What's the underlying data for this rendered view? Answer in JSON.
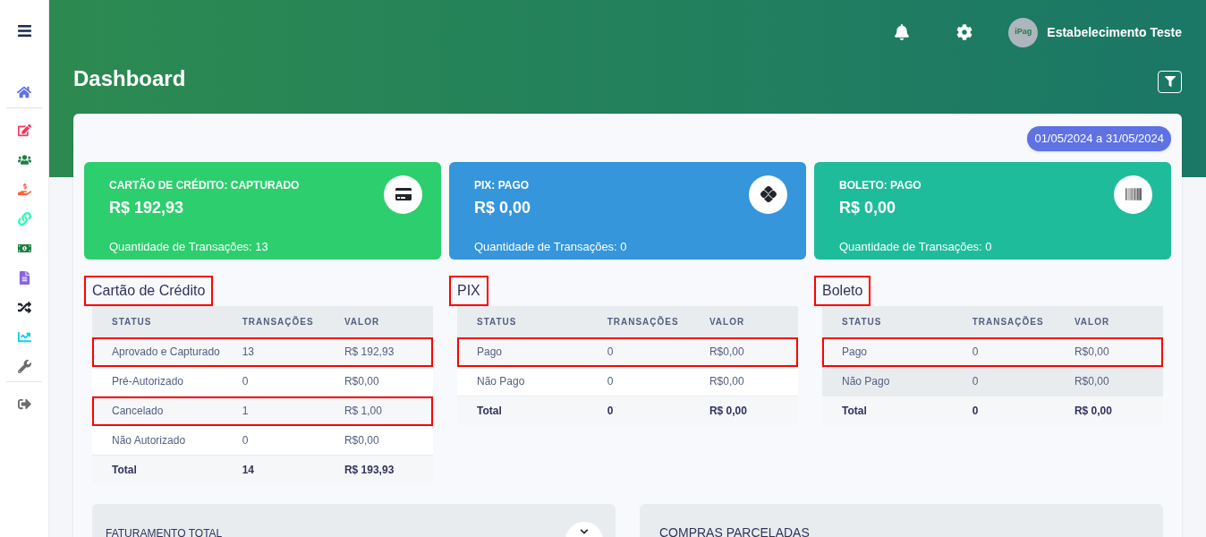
{
  "sidebar": {
    "items": [
      {
        "kind": "home",
        "color": "#5e72e4",
        "selected": true
      },
      {
        "kind": "edit",
        "color": "#f5365c",
        "selected": false
      },
      {
        "kind": "users",
        "color": "#1e7e46",
        "selected": false
      },
      {
        "kind": "hand",
        "color": "#fb6340",
        "selected": false
      },
      {
        "kind": "link",
        "color": "#2dfbb3",
        "selected": false
      },
      {
        "kind": "money",
        "color": "#1e7e46",
        "selected": false
      },
      {
        "kind": "file",
        "color": "#8965e0",
        "selected": false
      },
      {
        "kind": "shuffle",
        "color": "#212529",
        "selected": false
      },
      {
        "kind": "chart",
        "color": "#11cdef",
        "selected": false
      },
      {
        "kind": "wrench",
        "color": "#6c6c6c",
        "selected": false
      },
      {
        "kind": "logout",
        "color": "#6c6c6c",
        "selected": false
      }
    ]
  },
  "header": {
    "avatar_text": "iPag",
    "user_name": "Estabelecimento Teste"
  },
  "page_title": "Dashboard",
  "date_range": "01/05/2024 a 31/05/2024",
  "stat_cards": [
    {
      "kind": "card",
      "color": "#2dce6e",
      "title": "CARTÃO DE CRÉDITO: CAPTURADO",
      "amount": "R$ 192,93",
      "count": "Quantidade de Transações: 13"
    },
    {
      "kind": "pix",
      "color": "#3596db",
      "title": "PIX: PAGO",
      "amount": "R$ 0,00",
      "count": "Quantidade de Transações: 0"
    },
    {
      "kind": "barcode",
      "color": "#1fbc9c",
      "title": "BOLETO: PAGO",
      "amount": "R$ 0,00",
      "count": "Quantidade de Transações: 0"
    }
  ],
  "tables": [
    {
      "title": "Cartão de Crédito",
      "highlighted": true,
      "columns": [
        "STATUS",
        "TRANSAÇÕES",
        "VALOR"
      ],
      "rows": [
        {
          "cells": [
            "Aprovado e Capturado",
            "13",
            "R$ 192,93"
          ],
          "highlighted": true,
          "hovered": false
        },
        {
          "cells": [
            "Pré-Autorizado",
            "0",
            "R$0,00"
          ],
          "highlighted": false,
          "hovered": false
        },
        {
          "cells": [
            "Cancelado",
            "1",
            "R$ 1,00"
          ],
          "highlighted": true,
          "hovered": false
        },
        {
          "cells": [
            "Não Autorizado",
            "0",
            "R$0,00"
          ],
          "highlighted": false,
          "hovered": false
        }
      ],
      "total": [
        "Total",
        "14",
        "R$ 193,93"
      ]
    },
    {
      "title": "PIX",
      "highlighted": true,
      "columns": [
        "STATUS",
        "TRANSAÇÕES",
        "VALOR"
      ],
      "rows": [
        {
          "cells": [
            "Pago",
            "0",
            "R$0,00"
          ],
          "highlighted": true,
          "hovered": false
        },
        {
          "cells": [
            "Não Pago",
            "0",
            "R$0,00"
          ],
          "highlighted": false,
          "hovered": false
        }
      ],
      "total": [
        "Total",
        "0",
        "R$ 0,00"
      ]
    },
    {
      "title": "Boleto",
      "highlighted": true,
      "columns": [
        "STATUS",
        "TRANSAÇÕES",
        "VALOR"
      ],
      "rows": [
        {
          "cells": [
            "Pago",
            "0",
            "R$0,00"
          ],
          "highlighted": true,
          "hovered": false
        },
        {
          "cells": [
            "Não Pago",
            "0",
            "R$0,00"
          ],
          "highlighted": false,
          "hovered": true
        }
      ],
      "total": [
        "Total",
        "0",
        "R$ 0,00"
      ]
    }
  ],
  "panels": [
    {
      "title": "FATURAMENTO TOTAL",
      "has_button": true
    },
    {
      "title": "COMPRAS PARCELADAS",
      "has_button": false
    }
  ]
}
